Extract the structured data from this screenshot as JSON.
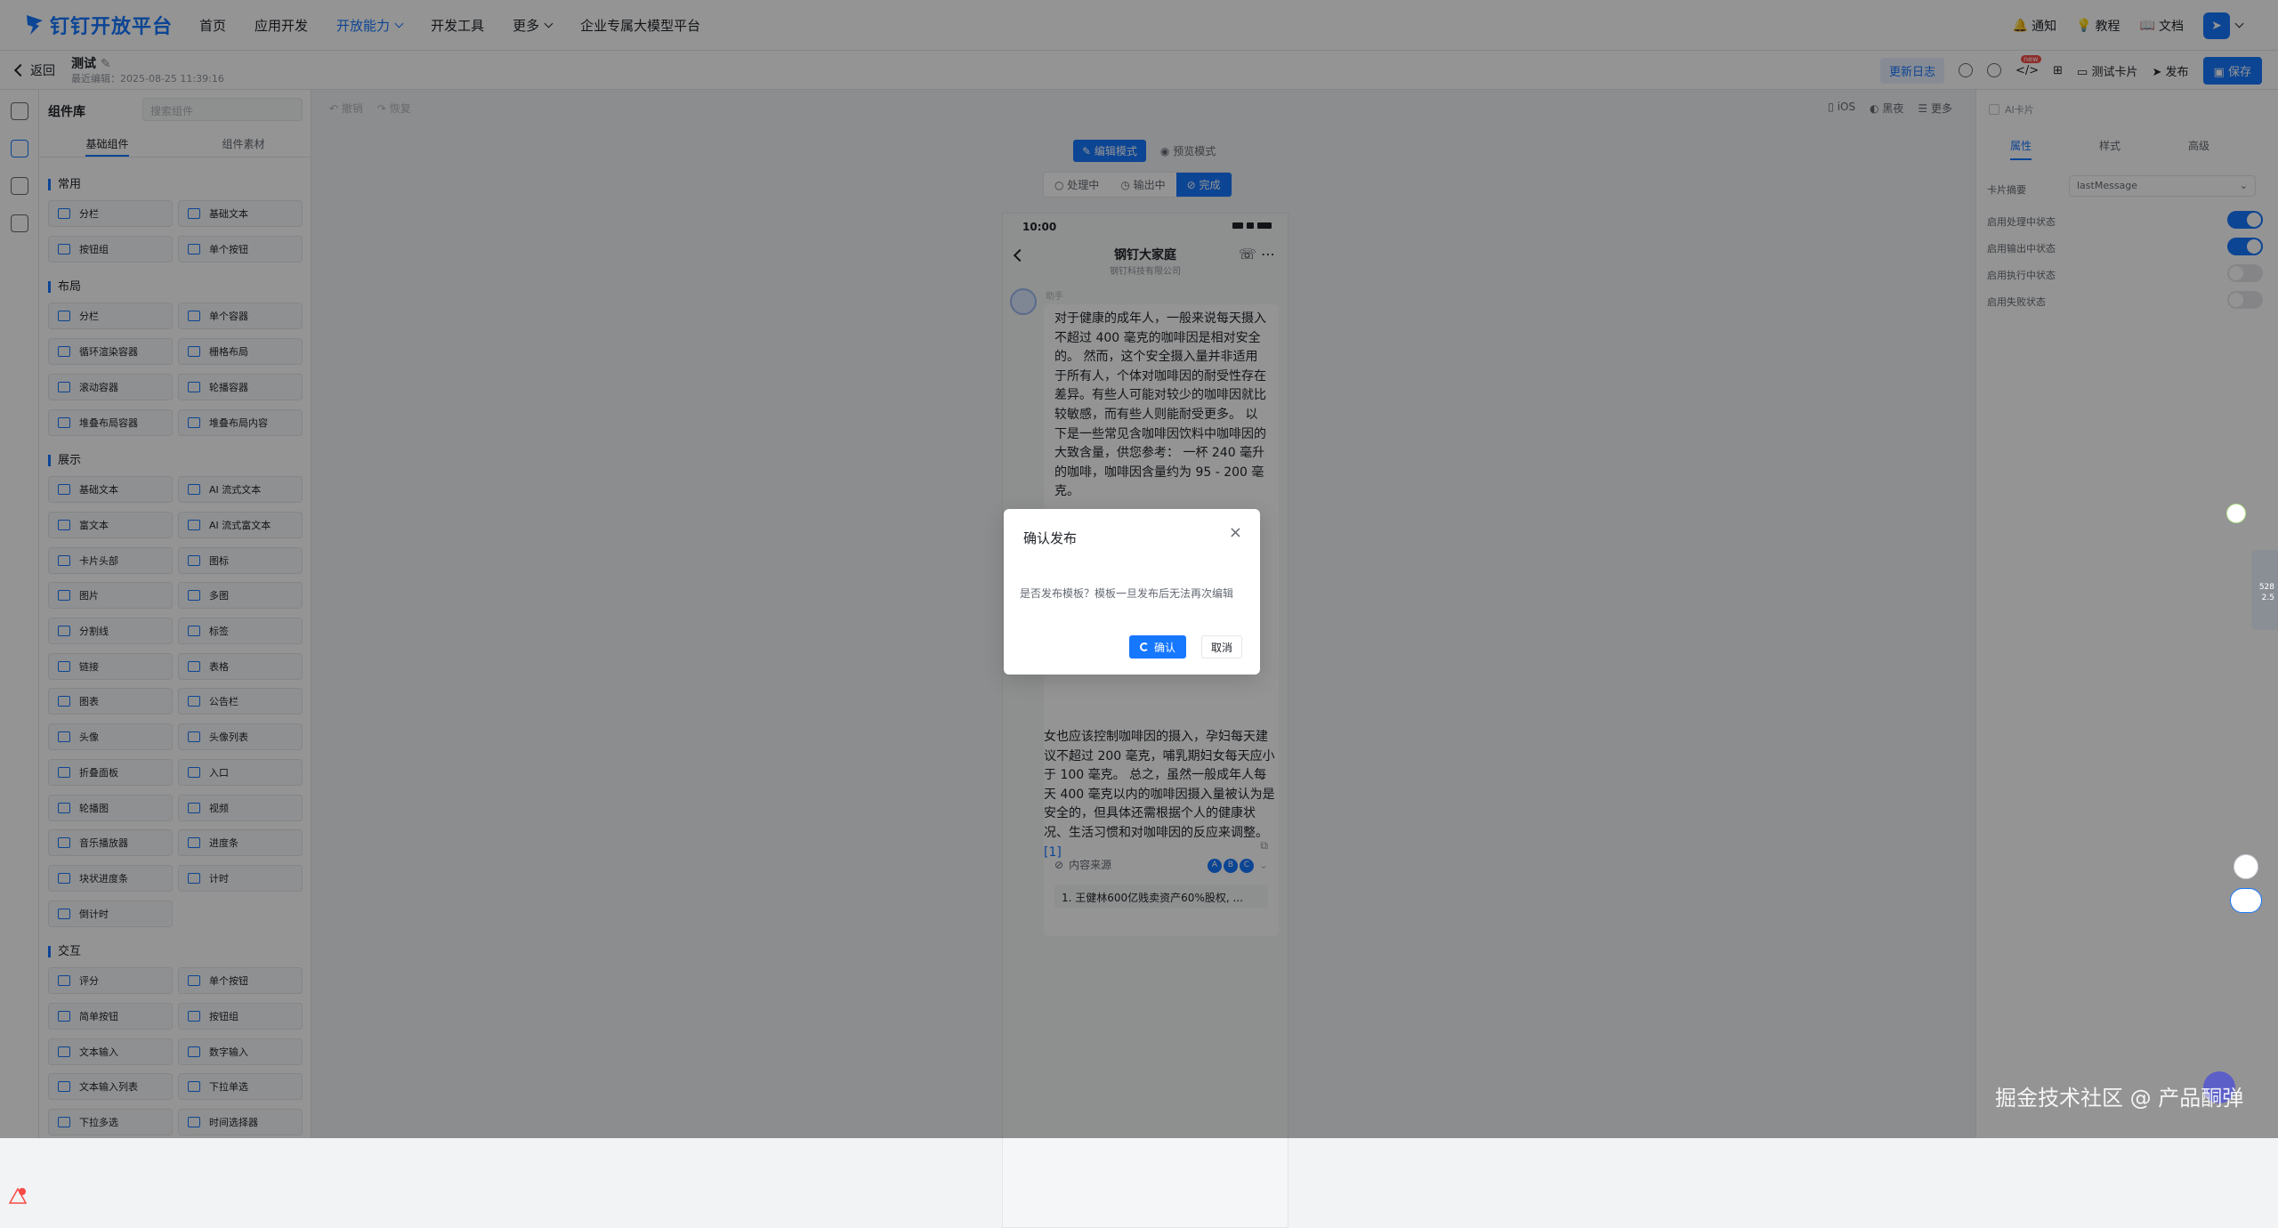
{
  "topnav": {
    "logo_text": "钉钉开放平台",
    "menu": [
      {
        "label": "首页",
        "active": false,
        "has_dropdown": false
      },
      {
        "label": "应用开发",
        "active": false,
        "has_dropdown": false
      },
      {
        "label": "开放能力",
        "active": true,
        "has_dropdown": true
      },
      {
        "label": "开发工具",
        "active": false,
        "has_dropdown": false
      },
      {
        "label": "更多",
        "active": false,
        "has_dropdown": true
      },
      {
        "label": "企业专属大模型平台",
        "active": false,
        "has_dropdown": false
      }
    ],
    "notify": "通知",
    "tutorial": "教程",
    "docs": "文档"
  },
  "subheader": {
    "back": "返回",
    "title": "测试",
    "edited_time": "最近编辑：2025-08-25 11:39:16",
    "update_log": "更新日志",
    "new_badge": "new",
    "test_card": "测试卡片",
    "publish": "发布",
    "save": "保存"
  },
  "panel": {
    "title": "组件库",
    "search_placeholder": "搜索组件",
    "tabs": [
      "基础组件",
      "组件素材"
    ],
    "sections": [
      {
        "title": "常用",
        "items": [
          "分栏",
          "基础文本",
          "按钮组",
          "单个按钮"
        ]
      },
      {
        "title": "布局",
        "items": [
          "分栏",
          "单个容器",
          "循环渲染容器",
          "栅格布局",
          "滚动容器",
          "轮播容器",
          "堆叠布局容器",
          "堆叠布局内容"
        ]
      },
      {
        "title": "展示",
        "items": [
          "基础文本",
          "AI 流式文本",
          "富文本",
          "AI 流式富文本",
          "卡片头部",
          "图标",
          "图片",
          "多图",
          "分割线",
          "标签",
          "链接",
          "表格",
          "图表",
          "公告栏",
          "头像",
          "头像列表",
          "折叠面板",
          "入口",
          "轮播图",
          "视频",
          "音乐播放器",
          "进度条",
          "块状进度条",
          "计时",
          "倒计时"
        ]
      },
      {
        "title": "交互",
        "items": [
          "评分",
          "单个按钮",
          "简单按钮",
          "按钮组",
          "文本输入",
          "数字输入",
          "文本输入列表",
          "下拉单选",
          "下拉多选",
          "时间选择器"
        ]
      }
    ]
  },
  "canvas": {
    "undo": "撤销",
    "redo": "恢复",
    "ios": "iOS",
    "dark": "黑夜",
    "more": "更多",
    "modes": [
      "编辑模式",
      "预览模式"
    ],
    "states": [
      "处理中",
      "输出中",
      "完成"
    ]
  },
  "phone": {
    "time": "10:00",
    "chat_name": "钢钉大家庭",
    "chat_sub": "钢钉科技有限公司",
    "bot_name": "助手",
    "message_top": "对于健康的成年人，一般来说每天摄入不超过 400 毫克的咖啡因是相对安全的。 然而，这个安全摄入量并非适用于所有人，个体对咖啡因的耐受性存在差异。有些人可能对较少的咖啡因就比较敏感，而有些人则能耐受更多。 以下是一些常见含咖啡因饮料中咖啡因的大致含量，供您参考： 一杯 240 毫升的咖啡，咖啡因含量约为 95 - 200 毫克。",
    "message_bottom": "女也应该控制咖啡因的摄入，孕妇每天建议不超过 200 毫克，哺乳期妇女每天应小于 100 毫克。 总之，虽然一般成年人每天 400 毫克以内的咖啡因摄入量被认为是安全的，但具体还需根据个人的健康状况、生活习惯和对咖啡因的反应来调整。",
    "citation": "[1]",
    "source_label": "内容来源",
    "source_dots": [
      "A",
      "B",
      "C"
    ],
    "source_item": "1. 王健林600亿贱卖资产60%股权, ..."
  },
  "props": {
    "ai_card": "AI卡片",
    "tabs": [
      "属性",
      "样式",
      "高级"
    ],
    "summary_label": "卡片摘要",
    "summary_value": "lastMessage",
    "rows": [
      {
        "label": "启用处理中状态",
        "on": true
      },
      {
        "label": "启用输出中状态",
        "on": true
      },
      {
        "label": "启用执行中状态",
        "on": false
      },
      {
        "label": "启用失败状态",
        "on": false
      }
    ]
  },
  "modal": {
    "title": "确认发布",
    "close": "×",
    "body": "是否发布模板？模板一旦发布后无法再次编辑",
    "confirm": "确认",
    "cancel": "取消"
  },
  "watermark": "掘金技术社区 @ 产品酮弹",
  "side_metrics": {
    "a": "528",
    "b": "2.5"
  },
  "colors": {
    "primary": "#1677ff",
    "overlay": "rgba(0,0,0,0.42)"
  }
}
